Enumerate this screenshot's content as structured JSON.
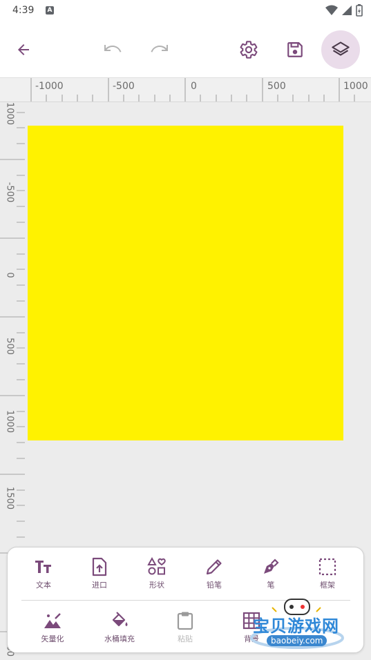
{
  "status": {
    "time": "4:39",
    "notification_letter": "A"
  },
  "toolbar": {
    "back_icon": "arrow-left-icon",
    "undo_icon": "undo-icon",
    "redo_icon": "redo-icon",
    "settings_icon": "gear-icon",
    "save_icon": "save-icon",
    "layers_icon": "layers-icon"
  },
  "ruler": {
    "horizontal": [
      "-1000",
      "-500",
      "0",
      "500",
      "1000"
    ],
    "vertical": [
      "1000",
      "-500",
      "0",
      "500",
      "1000",
      "1500",
      "2000",
      "2500"
    ]
  },
  "canvas": {
    "fill": "#fff200"
  },
  "tools_row1": [
    {
      "label": "文本",
      "icon": "text-icon"
    },
    {
      "label": "进口",
      "icon": "import-icon"
    },
    {
      "label": "形状",
      "icon": "shapes-icon"
    },
    {
      "label": "铅笔",
      "icon": "pencil-icon"
    },
    {
      "label": "笔",
      "icon": "pen-icon"
    },
    {
      "label": "框架",
      "icon": "frame-icon"
    }
  ],
  "tools_row2": [
    {
      "label": "矢量化",
      "icon": "vectorize-icon"
    },
    {
      "label": "水桶填充",
      "icon": "bucket-fill-icon"
    },
    {
      "label": "粘贴",
      "icon": "paste-icon"
    },
    {
      "label": "背景",
      "icon": "grid-icon"
    }
  ],
  "watermark": {
    "title": "宝贝游戏网",
    "url": "baobeiy.com"
  },
  "colors": {
    "accent": "#7b4a7b",
    "canvas_bg": "#ececec"
  }
}
